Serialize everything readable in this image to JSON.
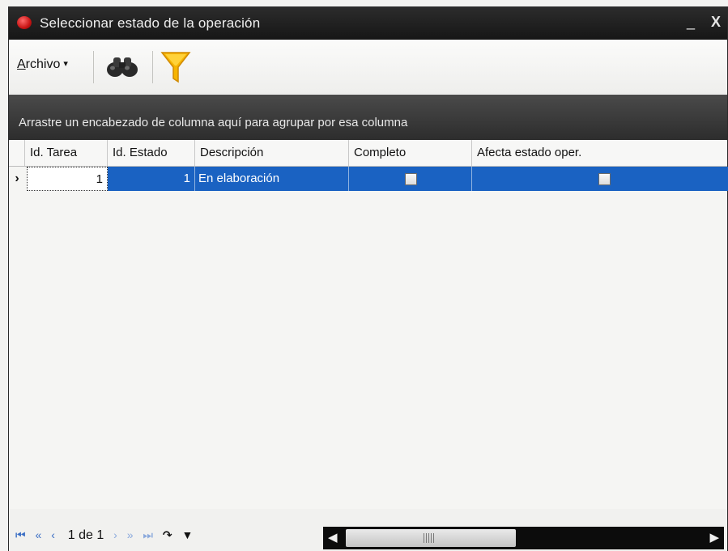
{
  "window": {
    "title": "Seleccionar estado de la operación",
    "minimize_glyph": "_",
    "close_glyph": "X"
  },
  "toolbar": {
    "archivo_label_first": "A",
    "archivo_label_rest": "rchivo",
    "archivo_caret": "▾",
    "find_icon": "binoculars-icon",
    "filter_icon": "filter-funnel-icon"
  },
  "group_panel": {
    "hint": "Arrastre un encabezado de columna aquí para agrupar por esa columna"
  },
  "grid": {
    "columns": [
      "Id. Tarea",
      "Id. Estado",
      "Descripción",
      "Completo",
      "Afecta estado oper."
    ],
    "rows": [
      {
        "indicator": "›",
        "id_tarea": "1",
        "id_estado": "1",
        "descripcion": "En elaboración",
        "completo": false,
        "afecta_estado_oper": false
      }
    ]
  },
  "footer": {
    "pager_text": "1 de 1",
    "nav_first": "⏮",
    "nav_prev_page": "«",
    "nav_prev": "‹",
    "nav_next": "›",
    "nav_next_page": "»",
    "nav_last": "⏭",
    "nav_refresh": "↷",
    "nav_filter": "▼",
    "scroll_left": "◀",
    "scroll_right": "▶"
  },
  "colors": {
    "selection": "#1a62c2",
    "titlebar": "#1e1e1e",
    "filter_icon": "#f6b400"
  }
}
